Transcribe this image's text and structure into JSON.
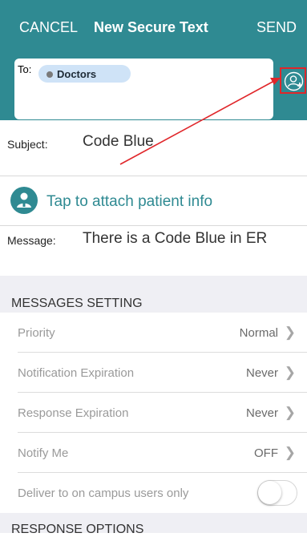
{
  "nav": {
    "cancel_label": "CANCEL",
    "title": "New Secure Text",
    "send_label": "SEND"
  },
  "to": {
    "label": "To:",
    "recipient_chip": "Doctors",
    "add_icon": "add-contact-icon"
  },
  "subject": {
    "label": "Subject:",
    "value": "Code Blue"
  },
  "attach": {
    "icon": "patient-icon",
    "label": "Tap to attach patient info"
  },
  "message": {
    "label": "Message:",
    "value": "There is a Code Blue in ER"
  },
  "settings": {
    "section_title": "MESSAGES SETTING",
    "rows": [
      {
        "label": "Priority",
        "value": "Normal"
      },
      {
        "label": "Notification Expiration",
        "value": "Never"
      },
      {
        "label": "Response Expiration",
        "value": "Never"
      },
      {
        "label": "Notify Me",
        "value": "OFF"
      }
    ],
    "campus_only": {
      "label": "Deliver to on campus users only",
      "on": false
    }
  },
  "response": {
    "section_title": "RESPONSE OPTIONS"
  },
  "colors": {
    "accent": "#2f8a92",
    "annotation_arrow": "#e0262a"
  }
}
